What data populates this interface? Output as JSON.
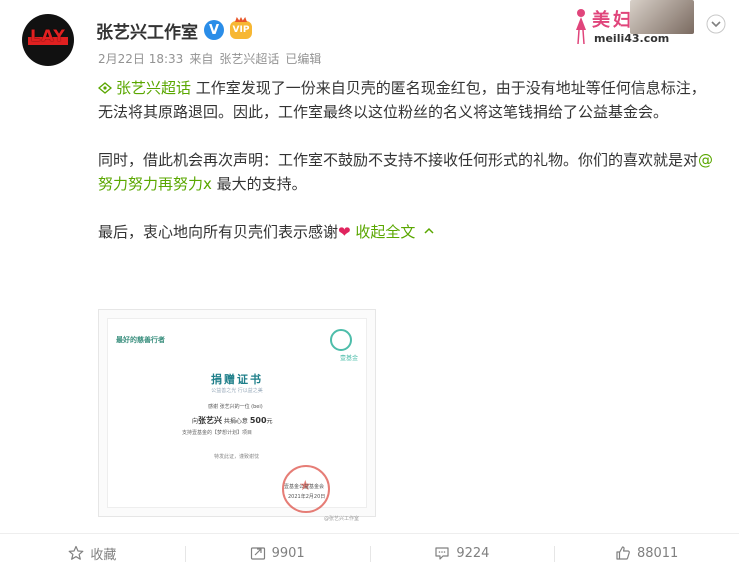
{
  "post": {
    "author": "张艺兴工作室",
    "avatar_text": "LAY",
    "verified_mark": "V",
    "vip_text": "VIP",
    "date": "2月22日 18:33",
    "source_prefix": "来自",
    "source": "张艺兴超话",
    "edited": "已编辑"
  },
  "watermark": {
    "title": "美妇网",
    "url": "meili43.com"
  },
  "content": {
    "topic": "张艺兴超话",
    "p1_rest": " 工作室发现了一份来自贝壳的匿名现金红包，由于没有地址等任何信息标注，无法将其原路退回。因此，工作室最终以这位粉丝的名义将这笔钱捐给了公益基金会。",
    "p2_before": "同时，借此机会再次声明：工作室不鼓励不支持不接收任何形式的礼物。你们的喜欢就是对",
    "mention": "@努力努力再努力x",
    "p2_after": " 最大的支持。",
    "p3": "最后，衷心地向所有贝壳们表示感谢",
    "heart": "❤",
    "collapse": "收起全文"
  },
  "certificate": {
    "org": "最好的慈善行者",
    "logo_label": "壹基金",
    "title": "捐赠证书",
    "subtitle": "公益善之光  行以益之美",
    "line1": "感谢 张艺兴的一位 (bei)",
    "line2_prefix": "向",
    "line2_name": "张艺兴",
    "line2_mid": " 共捐心意 ",
    "line2_amount": "500",
    "line2_suffix": "元",
    "line3": "支持壹基金的【梦想计划】项目",
    "line4": "特发此证，谨致谢忱",
    "sign": "壹基金公益基金会",
    "date": "2021年2月20日",
    "wm": "@张艺兴工作室"
  },
  "actions": {
    "favorite": "收藏",
    "repost": "9901",
    "comment": "9224",
    "like": "88011"
  },
  "colors": {
    "link_green": "#5aa700",
    "topic_orange": "#eb7350",
    "verified_blue": "#2a8de8"
  }
}
